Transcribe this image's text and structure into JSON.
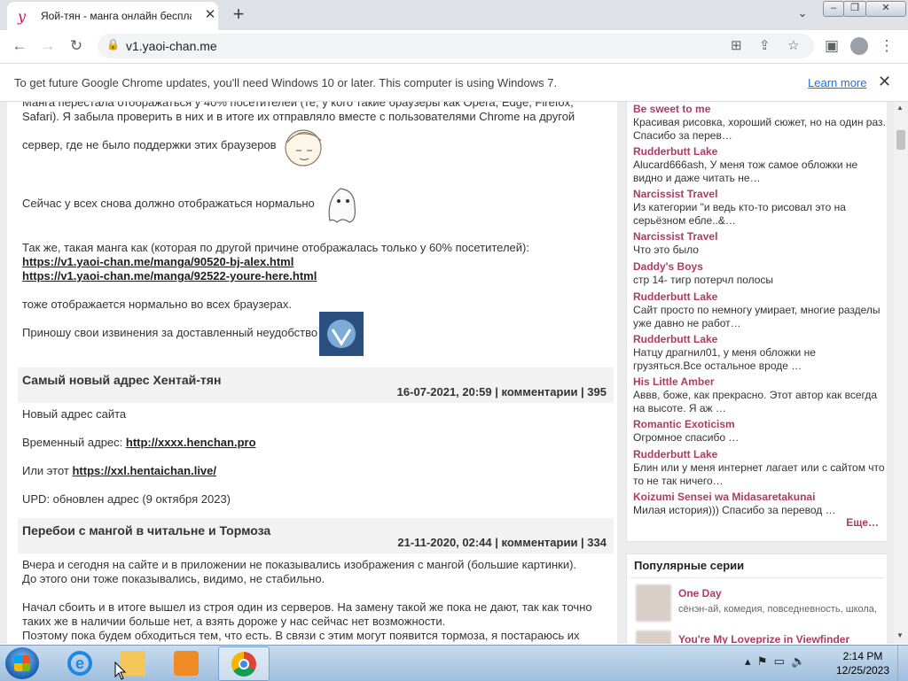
{
  "browser": {
    "tab_title": "Яой-тян - манга онлайн бесплатно",
    "url": "v1.yaoi-chan.me",
    "infobar_message": "To get future Google Chrome updates, you'll need Windows 10 or later. This computer is using Windows 7.",
    "infobar_link": "Learn more"
  },
  "article": {
    "lines": [
      "Манга перестала отображаться у 40% посетителей (те, у кого такие браузеры как Opera, Edge, Firefox,",
      "Safari). Я забыла проверить в них и в итоге их отправляло вместе с пользователями Chrome на другой",
      "сервер, где не было поддержки этих браузеров",
      "Сейчас у всех снова должно отображаться нормально",
      "Так же, такая манга как (которая по другой причине отображалась только у 60% посетителей):",
      "тоже отображается нормально во всех браузерах.",
      "Приношу свои извинения за доставленный неудобство"
    ],
    "links": [
      "https://v1.yaoi-chan.me/manga/90520-bj-alex.html",
      "https://v1.yaoi-chan.me/manga/92522-youre-here.html"
    ]
  },
  "posts": [
    {
      "title": "Самый новый адрес Хентай-тян",
      "meta": "16-07-2021, 20:59 | комментарии | 395",
      "line1": "Новый адрес сайта",
      "line2_prefix": "Временный адрес: ",
      "line2_link": "http://xxxx.henchan.pro",
      "line3_prefix": "Или этот ",
      "line3_link": "https://xxl.hentaichan.live/",
      "line4": "UPD: обновлен адрес (9 октября 2023)"
    },
    {
      "title": "Перебои с мангой в читальне и Тормоза",
      "meta": "21-11-2020, 02:44 | комментарии | 334",
      "line1": "Вчера и сегодня на сайте и в приложении не показывались изображения с мангой (большие картинки).",
      "line2": "До этого они тоже показывались, видимо, не стабильно.",
      "line3": "Начал сбоить и в итоге вышел из строя один из серверов. На замену такой же пока не дают, так как точно",
      "line4": "таких же в наличии больше нет, а взять дороже у нас сейчас нет возможности.",
      "line5": "Поэтому пока будем обходиться тем, что есть. В связи с этим могут появится тормоза, я постараюсь их"
    }
  ],
  "comments": [
    {
      "title": "Be sweet to me",
      "text": "Красивая рисовка, хороший сюжет, но на один раз. Спасибо за перев…"
    },
    {
      "title": "Rudderbutt Lake",
      "text": "Alucard666ash, У меня тож самое обложки не видно и даже читать не…"
    },
    {
      "title": "Narcissist Travel",
      "text": "Из категории \"и ведь кто-то рисовал это на серьёзном ебле..&…"
    },
    {
      "title": "Narcissist Travel",
      "text": "Что это было"
    },
    {
      "title": "Daddy's Boys",
      "text": "стр 14- тигр потерчл полосы"
    },
    {
      "title": "Rudderbutt Lake",
      "text": "Сайт просто по немногу умирает, многие разделы уже давно не работ…"
    },
    {
      "title": "Rudderbutt Lake",
      "text": "Натцу драгнил01, у меня обложки не грузяться.Все остальное вроде …"
    },
    {
      "title": "His Little Amber",
      "text": "Аввв, боже, как прекрасно. Этот автор как всегда на высоте. Я аж …"
    },
    {
      "title": "Romantic Exoticism",
      "text": "Огромное спасибо …"
    },
    {
      "title": "Rudderbutt Lake",
      "text": "Блин или у меня интернет лагает или с сайтом что то не так ничего…"
    },
    {
      "title": "Koizumi Sensei wa Midasaretakunai",
      "text": "Милая история))) Спасибо за перевод …"
    }
  ],
  "more_label": "Еще…",
  "popular": {
    "heading": "Популярные серии",
    "items": [
      {
        "name": "One Day",
        "tags": "сёнэн-ай, комедия, повседневность, школа,"
      },
      {
        "name": "You're My Loveprize in Viewfinder",
        "tags": ""
      }
    ]
  },
  "taskbar": {
    "time": "2:14 PM",
    "date": "12/25/2023"
  },
  "icons": [
    "yaoi-favicon",
    "close-tab-icon",
    "new-tab-icon",
    "tab-search-icon",
    "back-icon",
    "forward-icon",
    "reload-icon",
    "lock-icon",
    "translate-icon",
    "share-icon",
    "star-icon",
    "sidepanel-icon",
    "profile-icon",
    "menu-icon",
    "start-orb-icon",
    "ie-icon",
    "explorer-icon",
    "media-player-icon",
    "chrome-icon"
  ],
  "colors": {
    "accent_link": "#b03a66",
    "chrome_blue": "#1a73e8",
    "post_header_bg": "#f2f2f2"
  }
}
